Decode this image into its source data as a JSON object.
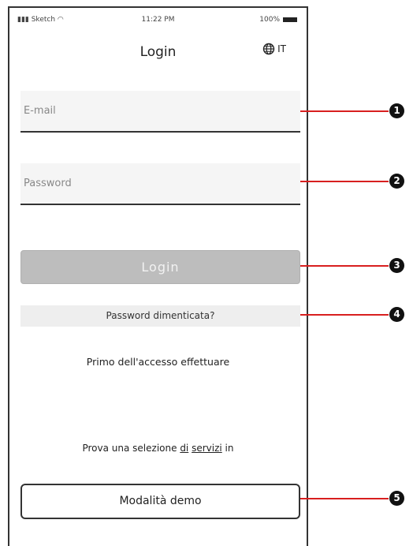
{
  "status_bar": {
    "carrier": "Sketch",
    "time": "11:22 PM",
    "battery": "100%"
  },
  "header": {
    "title": "Login",
    "language": "IT"
  },
  "form": {
    "email_placeholder": "E-mail",
    "password_placeholder": "Password",
    "login_label": "Login",
    "forgot_label": "Password dimenticata?"
  },
  "first_access_text": "Primo dell'accesso effettuare",
  "demo": {
    "prompt_pre": "Prova una selezione ",
    "prompt_word1": "di",
    "prompt_mid": " ",
    "prompt_word2": "servizi",
    "prompt_post": " in",
    "button_label": "Modalità demo"
  },
  "callouts": [
    "1",
    "2",
    "3",
    "4",
    "5"
  ],
  "colors": {
    "callout_line": "#d81f1f",
    "login_button_bg": "#bdbdbd",
    "field_bg": "#f5f5f5"
  }
}
